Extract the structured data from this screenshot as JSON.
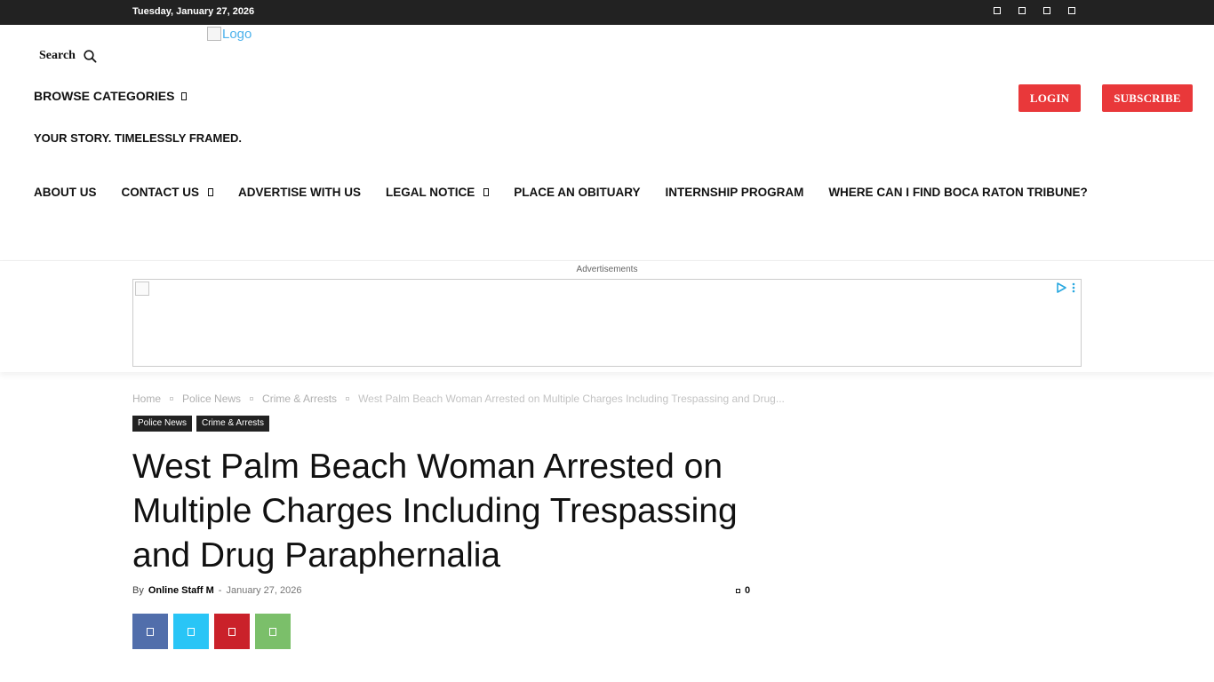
{
  "topbar": {
    "date": "Tuesday, January 27, 2026",
    "social_icons": [
      "facebook-icon",
      "instagram-icon",
      "twitter-icon",
      "youtube-icon"
    ]
  },
  "header": {
    "search_label": "Search",
    "logo_alt": "Logo",
    "browse_label": "BROWSE CATEGORIES",
    "login_label": "LOGIN",
    "subscribe_label": "SUBSCRIBE",
    "tagline": "YOUR STORY. TIMELESSLY FRAMED.",
    "accent_color": "#e9383a"
  },
  "nav": {
    "items": [
      {
        "label": "ABOUT US",
        "has_dropdown": false
      },
      {
        "label": "CONTACT US",
        "has_dropdown": true
      },
      {
        "label": "ADVERTISE WITH US",
        "has_dropdown": false
      },
      {
        "label": "LEGAL NOTICE",
        "has_dropdown": true
      },
      {
        "label": "PLACE AN OBITUARY",
        "has_dropdown": false
      },
      {
        "label": "INTERNSHIP PROGRAM",
        "has_dropdown": false
      },
      {
        "label": "WHERE CAN I FIND BOCA RATON TRIBUNE?",
        "has_dropdown": false
      }
    ]
  },
  "ad": {
    "label": "Advertisements"
  },
  "breadcrumb": {
    "items": [
      "Home",
      "Police News",
      "Crime & Arrests"
    ],
    "current": "West Palm Beach Woman Arrested on Multiple Charges Including Trespassing and Drug..."
  },
  "article": {
    "categories": [
      "Police News",
      "Crime & Arrests"
    ],
    "title": "West Palm Beach Woman Arrested on Multiple Charges Including Trespassing and Drug Paraphernalia",
    "by_label": "By",
    "author": "Online Staff M",
    "separator": "-",
    "date": "January 27, 2026",
    "comment_count": "0"
  },
  "share": {
    "buttons": [
      {
        "name": "facebook-share-button",
        "icon": "facebook-icon",
        "color": "#516eab"
      },
      {
        "name": "twitter-share-button",
        "icon": "twitter-icon",
        "color": "#29c5f6"
      },
      {
        "name": "pinterest-share-button",
        "icon": "pinterest-icon",
        "color": "#ca212a"
      },
      {
        "name": "whatsapp-share-button",
        "icon": "whatsapp-icon",
        "color": "#7bbf6a"
      }
    ]
  }
}
